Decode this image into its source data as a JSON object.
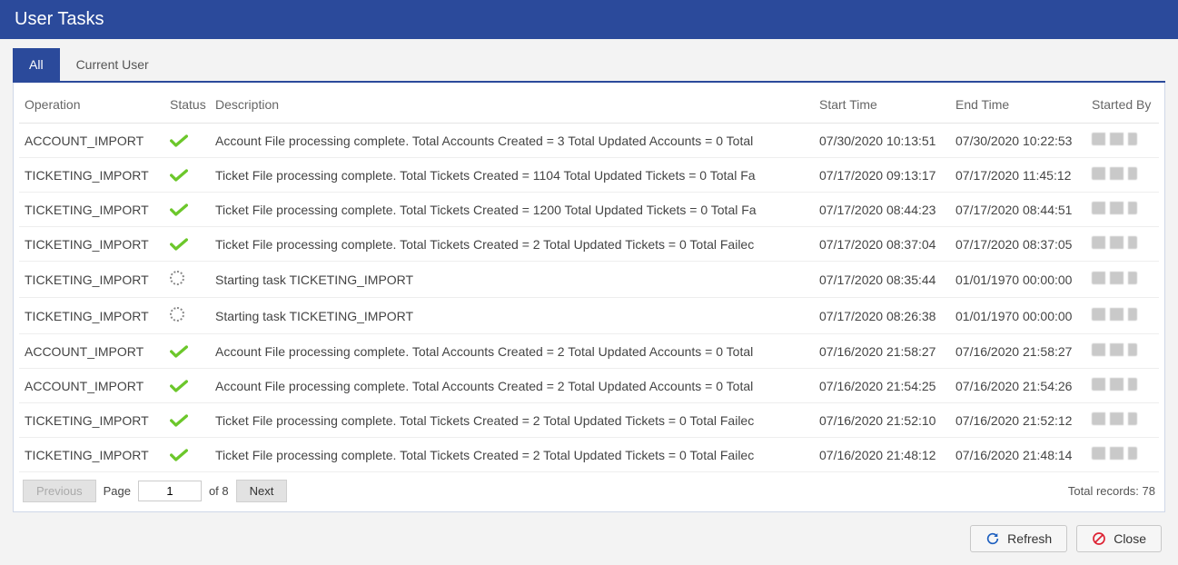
{
  "title": "User Tasks",
  "tabs": [
    {
      "label": "All",
      "active": true
    },
    {
      "label": "Current User",
      "active": false
    }
  ],
  "columns": {
    "operation": "Operation",
    "status": "Status",
    "description": "Description",
    "start_time": "Start Time",
    "end_time": "End Time",
    "started_by": "Started By"
  },
  "rows": [
    {
      "operation": "ACCOUNT_IMPORT",
      "status": "done",
      "description": "Account File processing complete. Total Accounts Created = 3 Total Updated Accounts = 0 Total",
      "start_time": "07/30/2020 10:13:51",
      "end_time": "07/30/2020 10:22:53",
      "started_by": ""
    },
    {
      "operation": "TICKETING_IMPORT",
      "status": "done",
      "description": "Ticket File processing complete. Total Tickets Created = 1104 Total Updated Tickets = 0 Total Fa",
      "start_time": "07/17/2020 09:13:17",
      "end_time": "07/17/2020 11:45:12",
      "started_by": ""
    },
    {
      "operation": "TICKETING_IMPORT",
      "status": "done",
      "description": "Ticket File processing complete. Total Tickets Created = 1200 Total Updated Tickets = 0 Total Fa",
      "start_time": "07/17/2020 08:44:23",
      "end_time": "07/17/2020 08:44:51",
      "started_by": ""
    },
    {
      "operation": "TICKETING_IMPORT",
      "status": "done",
      "description": "Ticket File processing complete. Total Tickets Created = 2 Total Updated Tickets = 0 Total Failec",
      "start_time": "07/17/2020 08:37:04",
      "end_time": "07/17/2020 08:37:05",
      "started_by": ""
    },
    {
      "operation": "TICKETING_IMPORT",
      "status": "running",
      "description": "Starting task TICKETING_IMPORT",
      "start_time": "07/17/2020 08:35:44",
      "end_time": "01/01/1970 00:00:00",
      "started_by": ""
    },
    {
      "operation": "TICKETING_IMPORT",
      "status": "running",
      "description": "Starting task TICKETING_IMPORT",
      "start_time": "07/17/2020 08:26:38",
      "end_time": "01/01/1970 00:00:00",
      "started_by": ""
    },
    {
      "operation": "ACCOUNT_IMPORT",
      "status": "done",
      "description": "Account File processing complete. Total Accounts Created = 2 Total Updated Accounts = 0 Total",
      "start_time": "07/16/2020 21:58:27",
      "end_time": "07/16/2020 21:58:27",
      "started_by": ""
    },
    {
      "operation": "ACCOUNT_IMPORT",
      "status": "done",
      "description": "Account File processing complete. Total Accounts Created = 2 Total Updated Accounts = 0 Total",
      "start_time": "07/16/2020 21:54:25",
      "end_time": "07/16/2020 21:54:26",
      "started_by": ""
    },
    {
      "operation": "TICKETING_IMPORT",
      "status": "done",
      "description": "Ticket File processing complete. Total Tickets Created = 2 Total Updated Tickets = 0 Total Failec",
      "start_time": "07/16/2020 21:52:10",
      "end_time": "07/16/2020 21:52:12",
      "started_by": ""
    },
    {
      "operation": "TICKETING_IMPORT",
      "status": "done",
      "description": "Ticket File processing complete. Total Tickets Created = 2 Total Updated Tickets = 0 Total Failec",
      "start_time": "07/16/2020 21:48:12",
      "end_time": "07/16/2020 21:48:14",
      "started_by": ""
    }
  ],
  "pager": {
    "previous_label": "Previous",
    "page_label": "Page",
    "page_current": "1",
    "of_text": "of 8",
    "next_label": "Next",
    "total_text": "Total records: 78"
  },
  "buttons": {
    "refresh": "Refresh",
    "close": "Close"
  }
}
